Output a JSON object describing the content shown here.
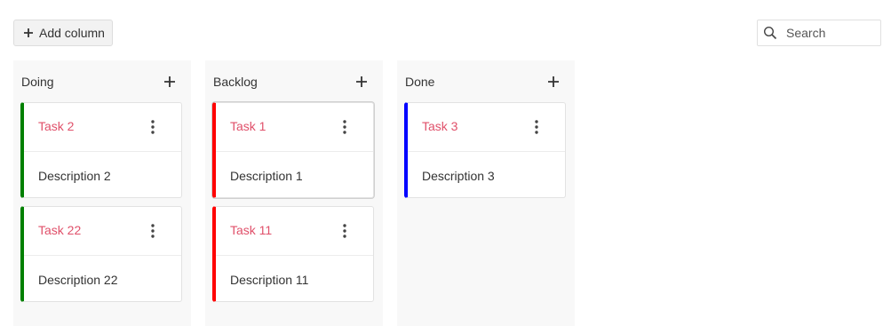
{
  "toolbar": {
    "add_column_label": "Add column",
    "search_placeholder": "Search",
    "search_value": ""
  },
  "colors": {
    "card_title": "#e0506a",
    "column_bg": "#f8f8f8"
  },
  "columns": [
    {
      "title": "Doing",
      "add_icon": "plus-icon",
      "cards": [
        {
          "title": "Task 2",
          "description": "Description 2",
          "color": "#008000",
          "menu_icon": "more-vertical-icon"
        },
        {
          "title": "Task 22",
          "description": "Description 22",
          "color": "#008000",
          "menu_icon": "more-vertical-icon"
        }
      ]
    },
    {
      "title": "Backlog",
      "add_icon": "plus-icon",
      "cards": [
        {
          "title": "Task 1",
          "description": "Description 1",
          "color": "#ff0000",
          "menu_icon": "more-vertical-icon"
        },
        {
          "title": "Task 11",
          "description": "Description 11",
          "color": "#ff0000",
          "menu_icon": "more-vertical-icon"
        }
      ]
    },
    {
      "title": "Done",
      "add_icon": "plus-icon",
      "cards": [
        {
          "title": "Task 3",
          "description": "Description 3",
          "color": "#0000ff",
          "menu_icon": "more-vertical-icon"
        }
      ]
    }
  ]
}
